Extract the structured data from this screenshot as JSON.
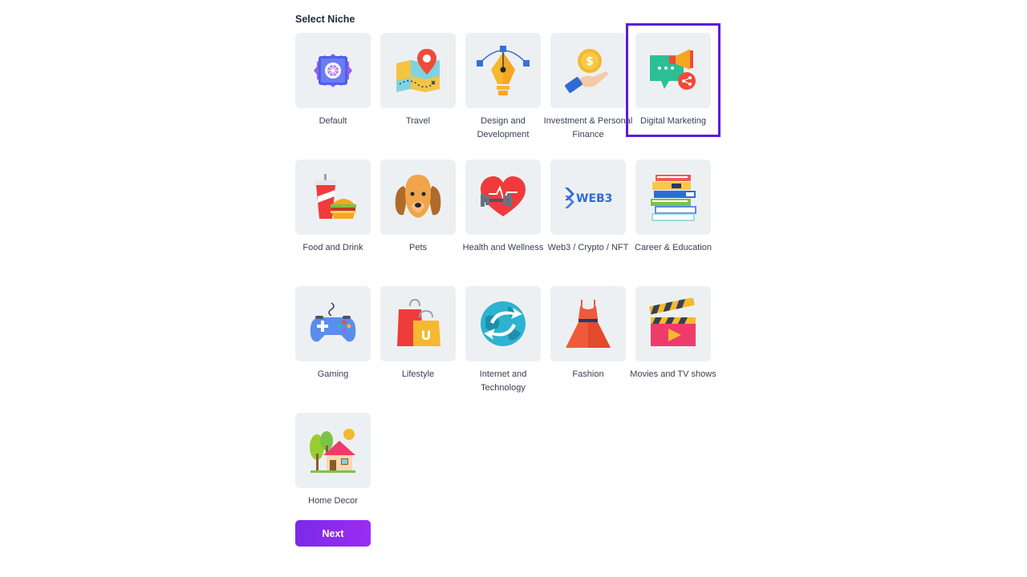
{
  "page": {
    "title": "Select Niche",
    "selected_niche": "Digital Marketing"
  },
  "niches": [
    {
      "label": "Default",
      "icon": "settings-gear-icon",
      "selected": false
    },
    {
      "label": "Travel",
      "icon": "map-pin-icon",
      "selected": false
    },
    {
      "label": "Design and Development",
      "icon": "pen-tool-icon",
      "selected": false
    },
    {
      "label": "Investment & Personal Finance",
      "icon": "coin-hand-icon",
      "selected": false
    },
    {
      "label": "Digital Marketing",
      "icon": "megaphone-chat-icon",
      "selected": true
    },
    {
      "label": "Food and Drink",
      "icon": "soda-burger-icon",
      "selected": false
    },
    {
      "label": "Pets",
      "icon": "dog-icon",
      "selected": false
    },
    {
      "label": "Health and Wellness",
      "icon": "heart-dumbbell-icon",
      "selected": false
    },
    {
      "label": "Web3 / Crypto / NFT",
      "icon": "web3-logo-icon",
      "icon_text": "WEB3",
      "selected": false
    },
    {
      "label": "Career & Education",
      "icon": "books-stack-icon",
      "selected": false
    },
    {
      "label": "Gaming",
      "icon": "gamepad-icon",
      "selected": false
    },
    {
      "label": "Lifestyle",
      "icon": "shopping-bags-icon",
      "icon_text": "U",
      "selected": false
    },
    {
      "label": "Internet and Technology",
      "icon": "globe-arrows-icon",
      "selected": false
    },
    {
      "label": "Fashion",
      "icon": "dress-icon",
      "selected": false
    },
    {
      "label": "Movies and TV shows",
      "icon": "clapperboard-icon",
      "selected": false
    },
    {
      "label": "Home Decor",
      "icon": "house-trees-icon",
      "selected": false
    }
  ],
  "actions": {
    "next_label": "Next"
  },
  "colors": {
    "accent": "#5b1bdc",
    "button_gradient_start": "#7c2ae8",
    "button_gradient_end": "#9b2cf0",
    "tile_background": "#edf0f3"
  }
}
